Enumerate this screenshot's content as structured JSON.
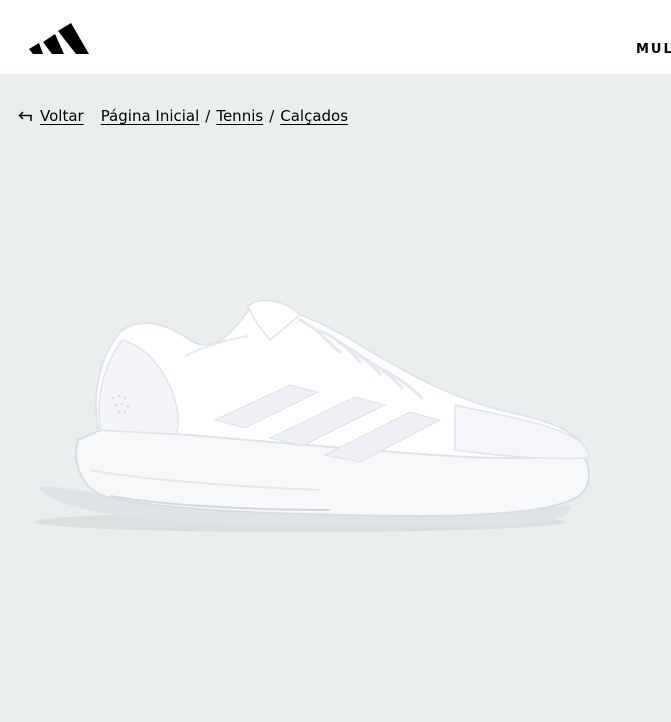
{
  "header": {
    "logo": "adidas-logo",
    "nav_item_partial": "MUL"
  },
  "breadcrumb": {
    "back_label": "Voltar",
    "back_icon": "arrow-back-icon",
    "items": [
      "Página Inicial",
      "Tennis",
      "Calçados"
    ],
    "separator": "/"
  },
  "product": {
    "image_icon": "white-tennis-shoe",
    "background_color": "#eaeeef"
  }
}
